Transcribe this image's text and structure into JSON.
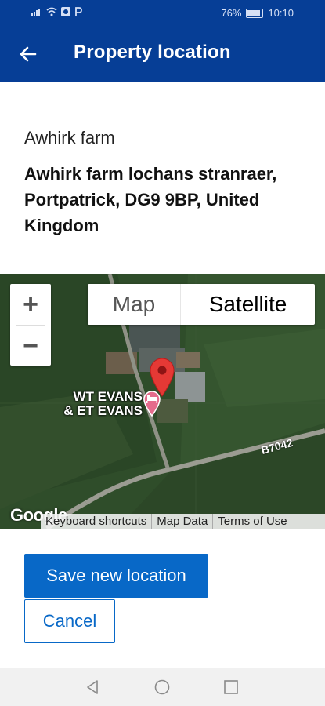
{
  "status_bar": {
    "battery": "76%",
    "time": "10:10"
  },
  "app_bar": {
    "title": "Property location",
    "back_icon": "arrow-left-icon"
  },
  "location": {
    "name": "Awhirk farm",
    "address": "Awhirk farm lochans stranraer, Portpatrick, DG9 9BP, United Kingdom"
  },
  "map": {
    "zoom_in": "+",
    "zoom_out": "−",
    "type_map": "Map",
    "type_satellite": "Satellite",
    "selected_type": "Satellite",
    "poi_label_line1": "WT EVANS",
    "poi_label_line2": "& ET EVANS",
    "road_label": "B7042",
    "logo_text": "Google",
    "footer": {
      "shortcuts": "Keyboard shortcuts",
      "map_data": "Map Data",
      "terms": "Terms of Use"
    }
  },
  "actions": {
    "save_label": "Save new location",
    "cancel_label": "Cancel"
  },
  "colors": {
    "primary_dark": "#063e96",
    "button_blue": "#0868c7",
    "marker_red": "#e53935",
    "poi_pink": "#e56b8c"
  }
}
